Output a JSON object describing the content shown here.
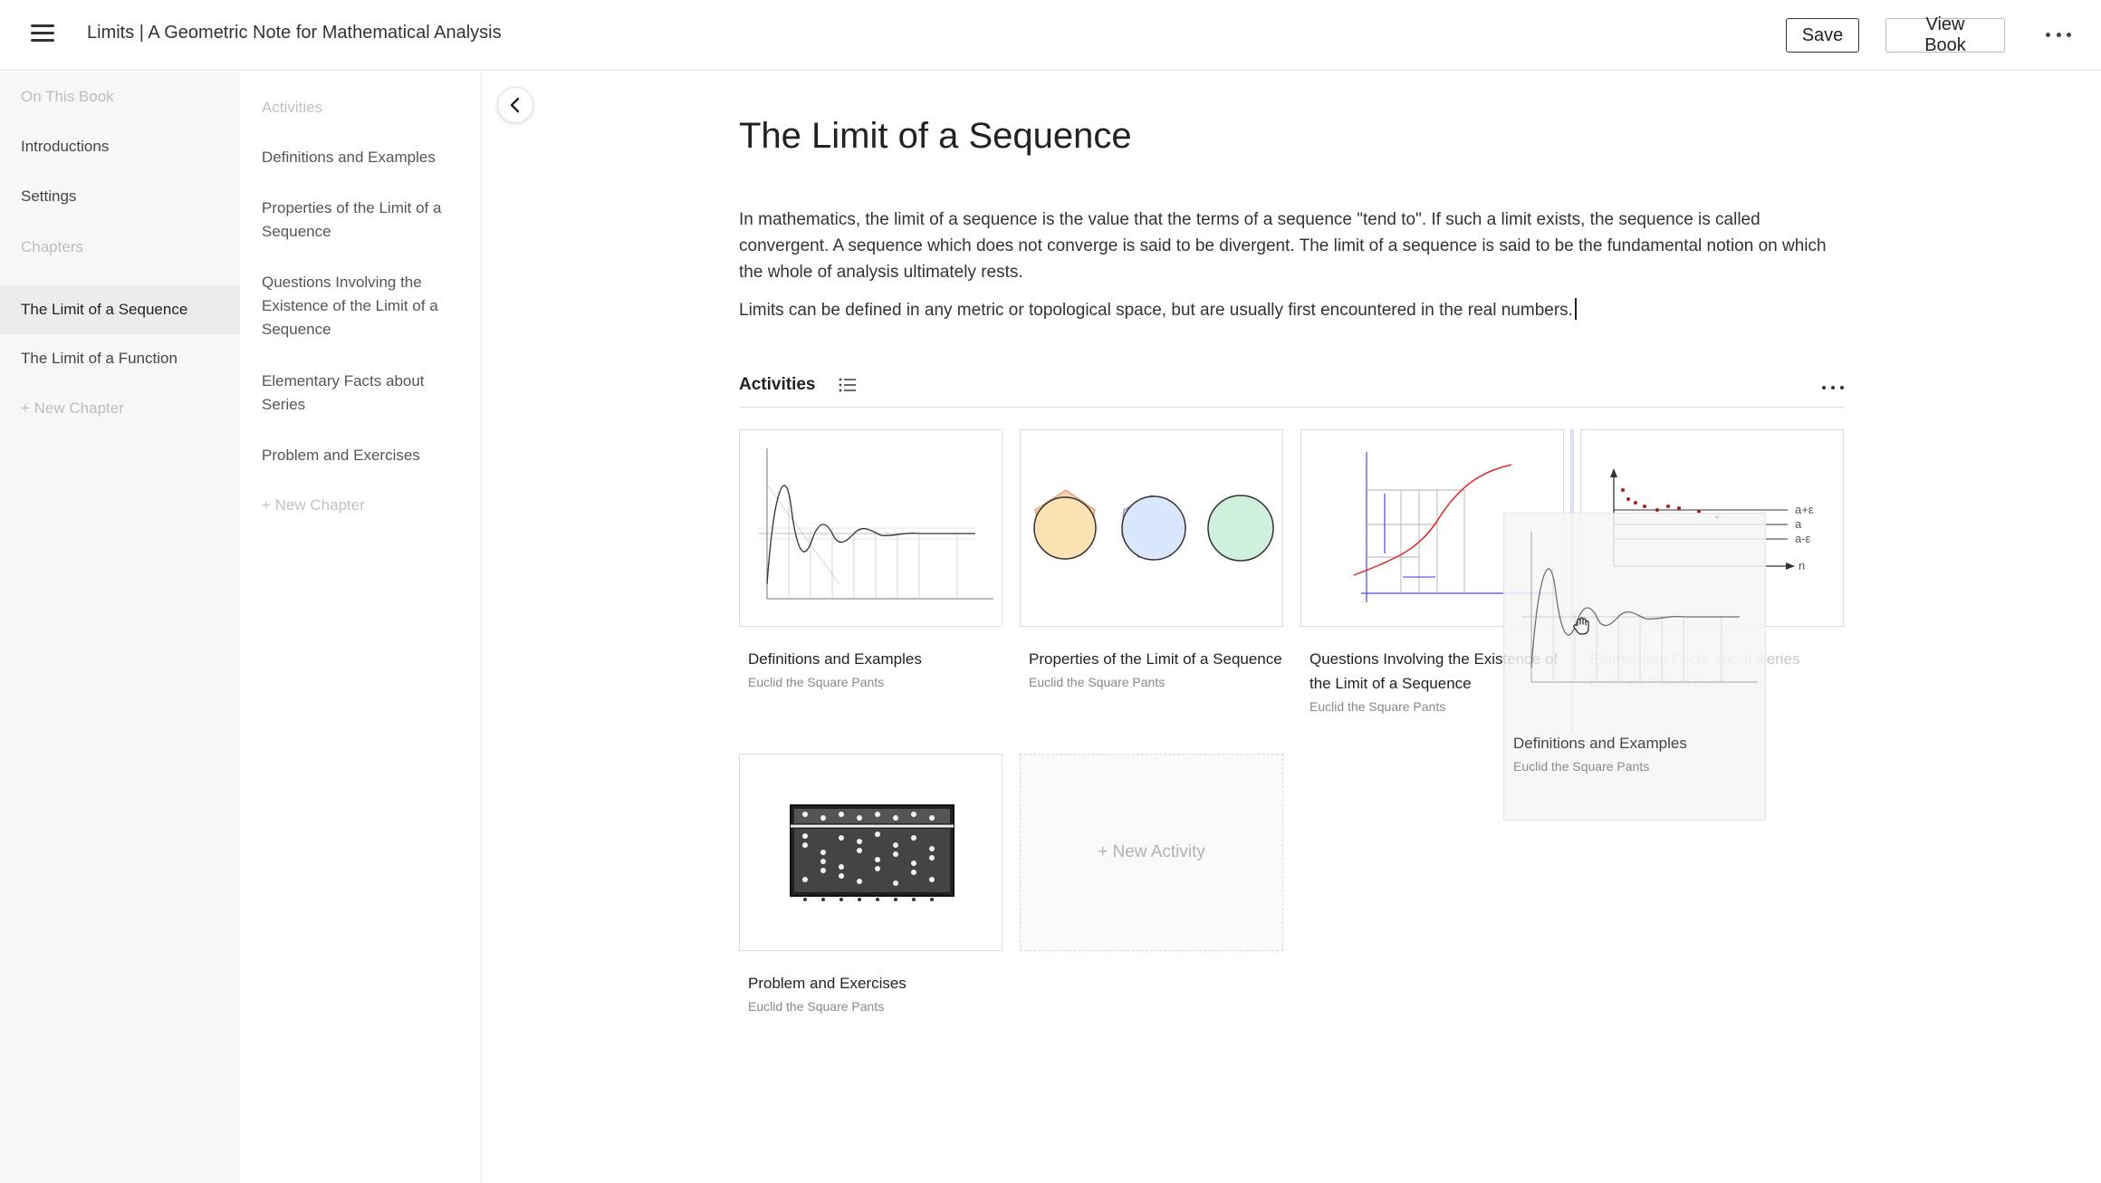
{
  "header": {
    "title": "Limits | A Geometric Note for Mathematical Analysis",
    "save_label": "Save",
    "view_book_label": "View Book"
  },
  "sidebar": {
    "items": [
      {
        "label": "On This Book",
        "kind": "section-heading"
      },
      {
        "label": "Introductions",
        "kind": "link"
      },
      {
        "label": "Settings",
        "kind": "link"
      },
      {
        "label": "Chapters",
        "kind": "section-heading"
      },
      {
        "label": "The Limit of a Sequence",
        "kind": "link",
        "active": true
      },
      {
        "label": "The Limit of a Function",
        "kind": "link"
      },
      {
        "label": "+ New Chapter",
        "kind": "add"
      }
    ]
  },
  "subnav": {
    "heading": "Activities",
    "items": [
      "Definitions and Examples",
      "Properties of the Limit of a Sequence",
      "Questions Involving the Existence of the Limit of a Sequence",
      "Elementary Facts about Series",
      "Problem and Exercises"
    ],
    "add_label": "+ New Chapter"
  },
  "main": {
    "title": "The Limit of a Sequence",
    "paragraphs": [
      "In mathematics, the limit of a sequence is the value that the terms of a sequence \"tend to\". If such a limit exists, the sequence is called convergent. A sequence which does not converge is said to be divergent. The limit of a sequence is said to be the fundamental notion on which the whole of analysis ultimately rests.",
      "Limits can be defined in any metric or topological space, but are usually first encountered in the real numbers."
    ],
    "activities_label": "Activities",
    "new_activity_label": "+ New Activity",
    "cards": [
      {
        "title": "Definitions and Examples",
        "author": "Euclid the Square Pants"
      },
      {
        "title": "Properties of the Limit of a Sequence",
        "author": "Euclid the Square Pants"
      },
      {
        "title": "Questions Involving the Existence of the Limit of a Sequence",
        "author": "Euclid the Square Pants"
      },
      {
        "title": "Elementary Facts about Series",
        "author": "Euclid the Square Pants"
      },
      {
        "title": "Problem and Exercises",
        "author": "Euclid the Square Pants"
      }
    ],
    "dragging_card": {
      "title": "Definitions and Examples",
      "author": "Euclid the Square Pants"
    }
  },
  "figure_labels": {
    "epsilon_upper": "a+ε",
    "a": "a",
    "epsilon_lower": "a-ε",
    "n": "n"
  },
  "colors": {
    "active_bg": "#ececec",
    "sidebar_bg": "#f7f7f7",
    "muted_text": "#bdbdbd",
    "curve_red": "#e03030",
    "axis_blue": "#3a3adf"
  },
  "icons": [
    "menu-icon",
    "chevron-left-icon",
    "list-icon",
    "more-horizontal-icon",
    "grab-hand-icon"
  ]
}
